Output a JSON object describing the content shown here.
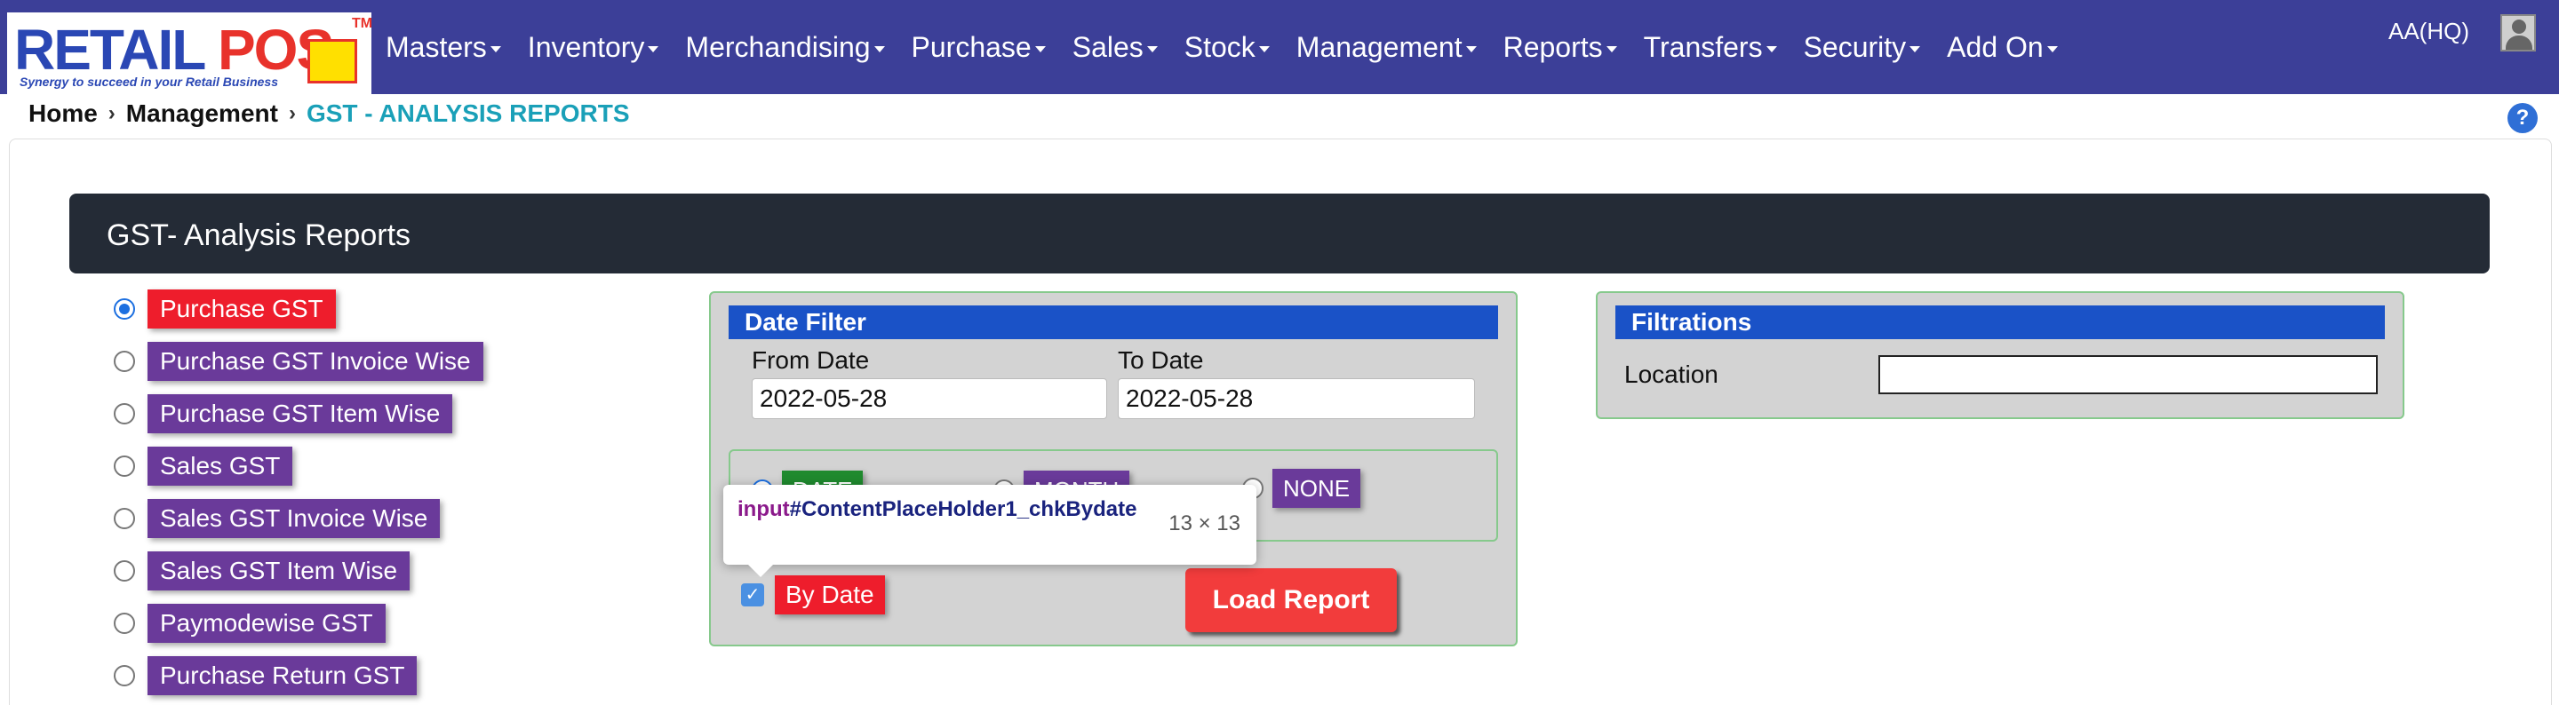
{
  "navbar": {
    "logo": {
      "brand_main": "RETAIL ",
      "brand_accent": "POS",
      "tm": "TM",
      "tagline": "Synergy to succeed in your Retail Business"
    },
    "items": [
      {
        "label": "Masters"
      },
      {
        "label": "Inventory"
      },
      {
        "label": "Merchandising"
      },
      {
        "label": "Purchase"
      },
      {
        "label": "Sales"
      },
      {
        "label": "Stock"
      },
      {
        "label": "Management"
      },
      {
        "label": "Reports"
      },
      {
        "label": "Transfers"
      },
      {
        "label": "Security"
      },
      {
        "label": "Add On"
      }
    ],
    "user": "AA(HQ)",
    "colors": {
      "bar": "#3c3f98"
    }
  },
  "breadcrumb": {
    "home": "Home",
    "section": "Management",
    "current": "GST - ANALYSIS REPORTS"
  },
  "help_icon": "?",
  "panel": {
    "title": "GST- Analysis Reports"
  },
  "reports": [
    {
      "label": "Purchase GST",
      "selected": true
    },
    {
      "label": "Purchase GST Invoice Wise",
      "selected": false
    },
    {
      "label": "Purchase GST Item Wise",
      "selected": false
    },
    {
      "label": "Sales GST",
      "selected": false
    },
    {
      "label": "Sales GST Invoice Wise",
      "selected": false
    },
    {
      "label": "Sales GST Item Wise",
      "selected": false
    },
    {
      "label": "Paymodewise GST",
      "selected": false
    },
    {
      "label": "Purchase Return GST",
      "selected": false
    }
  ],
  "date_filter": {
    "title": "Date Filter",
    "from_label": "From Date",
    "from_value": "2022-05-28",
    "to_label": "To Date",
    "to_value": "2022-05-28",
    "options": [
      {
        "label": "DATE"
      },
      {
        "label": "MONTH"
      },
      {
        "label": "NONE"
      }
    ],
    "by_date_label": "By Date",
    "by_date_checked": true,
    "load_button": "Load Report"
  },
  "tooltip": {
    "tag": "input",
    "id": "#ContentPlaceHolder1_chkBydate",
    "size": "13 × 13"
  },
  "filtrations": {
    "title": "Filtrations",
    "location_label": "Location",
    "location_value": ""
  },
  "colors": {
    "accent_red": "#ee1d2c",
    "accent_purple": "#6a3a9a",
    "section_blue": "#1a52c7",
    "panel_dark": "#242b36"
  }
}
